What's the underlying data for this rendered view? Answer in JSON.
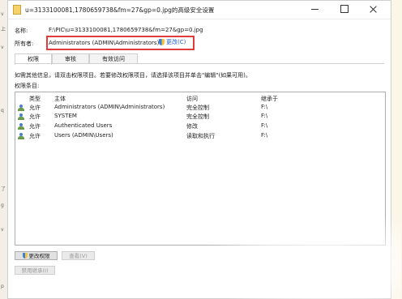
{
  "window": {
    "title": "u=3133100081,1780659738&fm=27&gp=0.jpg的高级安全设置"
  },
  "name_row": {
    "label": "名称:",
    "value": "F:\\PIC\\u=3133100081,1780659738&fm=27&gp=0.jpg"
  },
  "owner_row": {
    "label": "所有者:",
    "value": "Administrators (ADMIN\\Administrators)",
    "change_link": "更改(C)"
  },
  "tabs": [
    {
      "label": "权限",
      "active": true
    },
    {
      "label": "审核",
      "active": false
    },
    {
      "label": "有效访问",
      "active": false
    }
  ],
  "info_text": "如需其他信息，请双击权限项目。若要修改权限项目，请选择该项目并单击\"编辑\"(如果可用)。",
  "entries_label": "权限条目:",
  "table": {
    "columns": [
      "类型",
      "主体",
      "访问",
      "继承于"
    ],
    "rows": [
      {
        "type": "允许",
        "principal": "Administrators (ADMIN\\Administrators)",
        "access": "完全控制",
        "inherited": "F:\\"
      },
      {
        "type": "允许",
        "principal": "SYSTEM",
        "access": "完全控制",
        "inherited": "F:\\"
      },
      {
        "type": "允许",
        "principal": "Authenticated Users",
        "access": "修改",
        "inherited": "F:\\"
      },
      {
        "type": "允许",
        "principal": "Users (ADMIN\\Users)",
        "access": "读取和执行",
        "inherited": "F:\\"
      }
    ]
  },
  "buttons": {
    "change_permissions": "更改权限",
    "view": "查看(V)",
    "disable_inheritance": "禁用继承(I)"
  },
  "side_strip": [
    "v",
    "上",
    "v",
    "q",
    "了",
    "g",
    "v",
    "p"
  ],
  "colors": {
    "highlight_border": "#e13b3b",
    "link": "#1b5fd1"
  }
}
